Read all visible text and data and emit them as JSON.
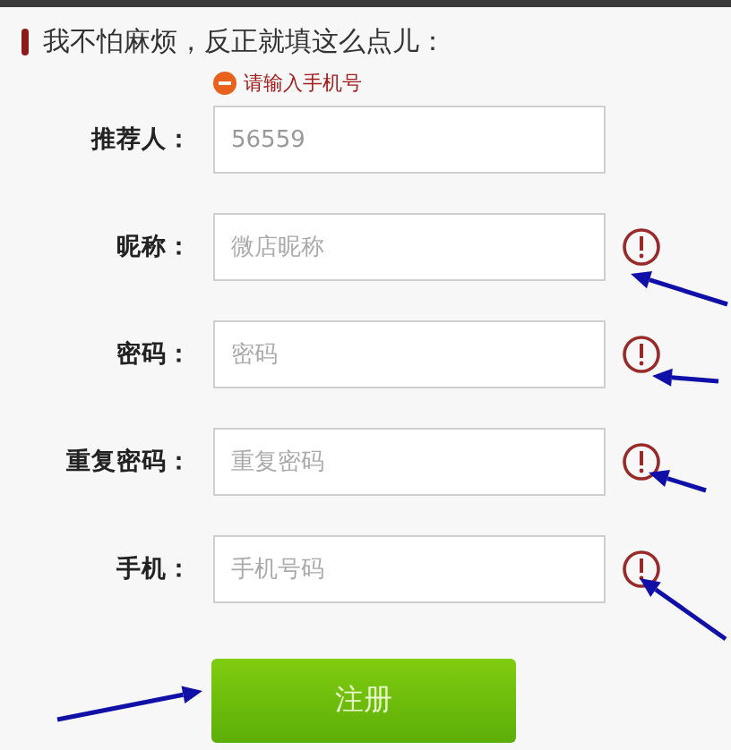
{
  "heading": "我不怕麻烦，反正就填这么点儿：",
  "error_hint": "请输入手机号",
  "fields": [
    {
      "label": "推荐人：",
      "value": "56559",
      "warning": false
    },
    {
      "label": "昵称：",
      "placeholder": "微店昵称",
      "warning": true
    },
    {
      "label": "密码：",
      "placeholder": "密码",
      "warning": true
    },
    {
      "label": "重复密码：",
      "placeholder": "重复密码",
      "warning": true
    },
    {
      "label": "手机：",
      "placeholder": "手机号码",
      "warning": true
    }
  ],
  "submit_button": "注册"
}
